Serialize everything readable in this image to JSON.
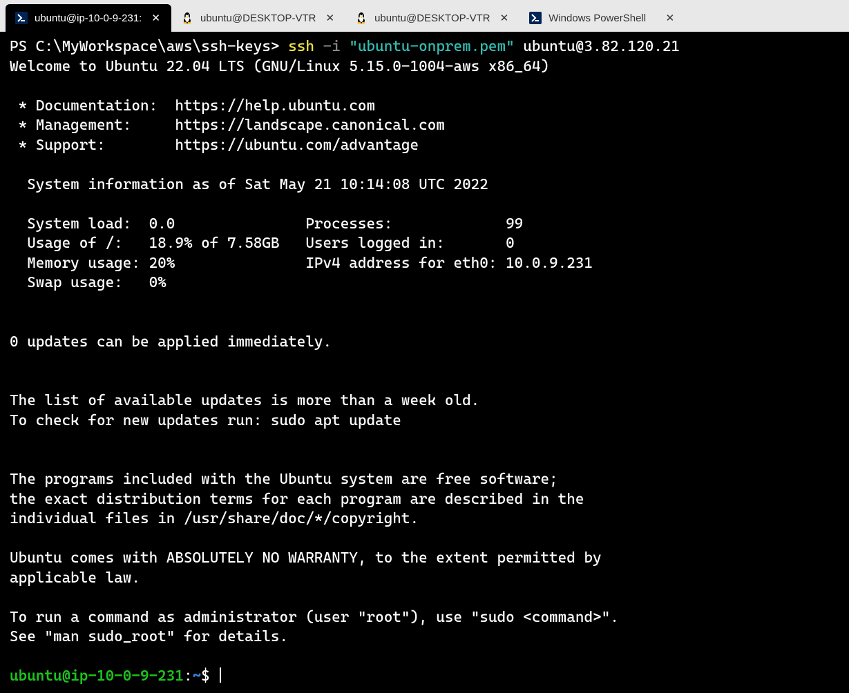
{
  "tabs": [
    {
      "label": "ubuntu@ip-10-0-9-231:",
      "icon": "powershell",
      "active": true
    },
    {
      "label": "ubuntu@DESKTOP-VTR",
      "icon": "tux",
      "active": false
    },
    {
      "label": "ubuntu@DESKTOP-VTR",
      "icon": "tux",
      "active": false
    },
    {
      "label": "Windows PowerShell",
      "icon": "powershell",
      "active": false
    }
  ],
  "ps_prompt": "PS C:\\MyWorkspace\\aws\\ssh-keys> ",
  "cmd": {
    "ssh": "ssh",
    "flag": "-i",
    "key": "\"ubuntu-onprem.pem\"",
    "dest": "ubuntu@3.82.120.21"
  },
  "welcome": "Welcome to Ubuntu 22.04 LTS (GNU/Linux 5.15.0-1004-aws x86_64)",
  "links": {
    "doc_label": " * Documentation:  ",
    "doc_url": "https://help.ubuntu.com",
    "man_label": " * Management:     ",
    "man_url": "https://landscape.canonical.com",
    "sup_label": " * Support:        ",
    "sup_url": "https://ubuntu.com/advantage"
  },
  "sysinfo_header": "  System information as of Sat May 21 10:14:08 UTC 2022",
  "sysinfo": {
    "r1": "  System load:  0.0               Processes:             99",
    "r2": "  Usage of /:   18.9% of 7.58GB   Users logged in:       0",
    "r3": "  Memory usage: 20%               IPv4 address for eth0: 10.0.9.231",
    "r4": "  Swap usage:   0%"
  },
  "updates_line": "0 updates can be applied immediately.",
  "updates_stale": {
    "l1": "The list of available updates is more than a week old.",
    "l2": "To check for new updates run: sudo apt update"
  },
  "legal": {
    "l1": "The programs included with the Ubuntu system are free software;",
    "l2": "the exact distribution terms for each program are described in the",
    "l3": "individual files in /usr/share/doc/*/copyright.",
    "l4": "Ubuntu comes with ABSOLUTELY NO WARRANTY, to the extent permitted by",
    "l5": "applicable law."
  },
  "sudo_hint": {
    "l1": "To run a command as administrator (user \"root\"), use \"sudo <command>\".",
    "l2": "See \"man sudo_root\" for details."
  },
  "shell_prompt": {
    "userhost": "ubuntu@ip-10-0-9-231",
    "colon": ":",
    "path": "~",
    "sigil": "$ "
  }
}
